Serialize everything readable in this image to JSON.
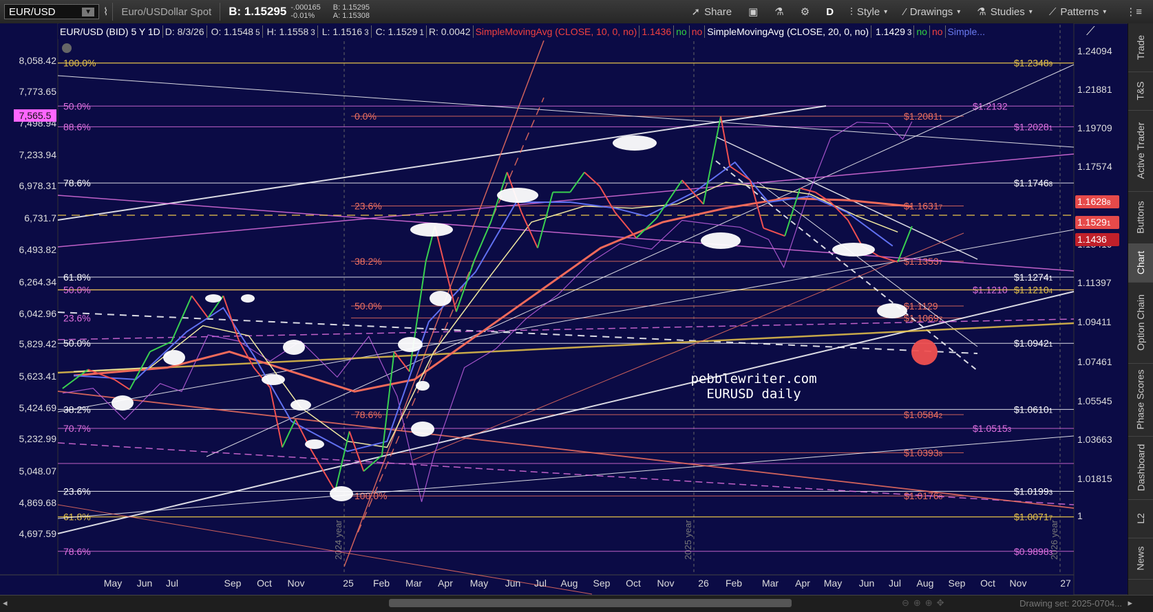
{
  "toolbar": {
    "symbol": "EUR/USD",
    "description": "Euro/USDollar Spot",
    "bid": "B: 1.15295",
    "change": "-.000165",
    "change_pct": "-0.01%",
    "bid_small": "B: 1.15295",
    "ask_small": "A: 1.15308",
    "share": "Share",
    "period": "D",
    "style": "Style",
    "drawings": "Drawings",
    "studies": "Studies",
    "patterns": "Patterns"
  },
  "infobar": {
    "title": "EUR/USD (BID) 5 Y 1D",
    "date": "D: 8/3/26",
    "open": "O: 1.1548",
    "open_sub": "5",
    "high": "H: 1.1558",
    "high_sub": "3",
    "low": "L: 1.1516",
    "low_sub": "3",
    "close": "C: 1.1529",
    "close_sub": "1",
    "range": "R: 0.0042",
    "sma10": "SimpleMovingAvg (CLOSE, 10, 0, no)",
    "sma10_val": "1.1436",
    "sma20": "SimpleMovingAvg (CLOSE, 20, 0, no)",
    "sma20_val": "1.1429",
    "sma20_sub": "3",
    "yes": "no",
    "no": "no",
    "more": "Simple..."
  },
  "sidebar": [
    "Trade",
    "T&S",
    "Active Trader",
    "Buttons",
    "Chart",
    "Option Chain",
    "Phase Scores",
    "Dashboard",
    "L2",
    "News"
  ],
  "bottombar": {
    "drawing_set": "Drawing set: 2025-0704..."
  },
  "watermark": [
    "pebblewriter.com",
    "EURUSD daily"
  ],
  "chart_data": {
    "type": "line",
    "title": "EUR/USD (BID) 5 Y 1D",
    "x_labels": [
      "May",
      "Jun",
      "Jul",
      "Sep",
      "Oct",
      "Nov",
      "25",
      "Feb",
      "Mar",
      "Apr",
      "May",
      "Jun",
      "Jul",
      "Aug",
      "Sep",
      "Oct",
      "Nov",
      "26",
      "Feb",
      "Mar",
      "Apr",
      "May",
      "Jun",
      "Jul",
      "Aug",
      "Sep",
      "Oct",
      "Nov",
      "27"
    ],
    "year_markers": [
      "2024 year",
      "2025 year",
      "2026 year"
    ],
    "y_right_ticks": [
      "1.24094",
      "1.21881",
      "1.19709",
      "1.17574",
      "1.15477",
      "1.13419",
      "1.11397",
      "1.09411",
      "1.07461",
      "1.05545",
      "1.03663",
      "1.01815",
      "1"
    ],
    "y_left_ticks": [
      "8,058.42",
      "7,773.65",
      "7,498.94",
      "7,233.94",
      "6,978.31",
      "6,731.7",
      "6,493.82",
      "6,264.34",
      "6,042.96",
      "5,829.42",
      "5,623.41",
      "5,424.69",
      "5,232.99",
      "5,048.07",
      "4,869.68",
      "4,697.59"
    ],
    "ylim": [
      0.978,
      1.254
    ],
    "price_markers": [
      {
        "label": "1.1628",
        "color": "#e64a4a",
        "sub": "8"
      },
      {
        "label": "1.1529",
        "color": "#e64a4a",
        "sub": "1"
      },
      {
        "label": "1.1436",
        "color": "#c0202a",
        "sub": ""
      }
    ],
    "left_marker": "7,565.5",
    "horizontal_levels": [
      {
        "price": 1.2348,
        "label": "$1.2348",
        "sub": "9",
        "color": "#e8c44a"
      },
      {
        "price": 1.2132,
        "label": "$1.2132",
        "sub": "",
        "color": "#e070e0"
      },
      {
        "price": 1.2081,
        "label": "$1.2081",
        "sub": "1",
        "color": "#f07060"
      },
      {
        "price": 1.2028,
        "label": "$1.2028",
        "sub": "1",
        "color": "#e070e0"
      },
      {
        "price": 1.1746,
        "label": "$1.1746",
        "sub": "8",
        "color": "#ffffff"
      },
      {
        "price": 1.1631,
        "label": "$1.1631",
        "sub": "7",
        "color": "#f07060"
      },
      {
        "price": 1.1353,
        "label": "$1.1353",
        "sub": "7",
        "color": "#f07060"
      },
      {
        "price": 1.1274,
        "label": "$1.1274",
        "sub": "1",
        "color": "#ffffff"
      },
      {
        "price": 1.121,
        "label": "$1.1210",
        "sub": "",
        "color": "#e070e0"
      },
      {
        "price": 1.121,
        "label": "$1.1210",
        "sub": "4",
        "color": "#e8c44a"
      },
      {
        "price": 1.1129,
        "label": "$1.1129",
        "sub": "",
        "color": "#f07060"
      },
      {
        "price": 1.1069,
        "label": "$1.1069",
        "sub": "7",
        "color": "#f07060"
      },
      {
        "price": 1.0942,
        "label": "$1.0942",
        "sub": "1",
        "color": "#ffffff"
      },
      {
        "price": 1.061,
        "label": "$1.0610",
        "sub": "1",
        "color": "#ffffff"
      },
      {
        "price": 1.0584,
        "label": "$1.0584",
        "sub": "2",
        "color": "#f07060"
      },
      {
        "price": 1.0515,
        "label": "$1.0515",
        "sub": "3",
        "color": "#e070e0"
      },
      {
        "price": 1.0393,
        "label": "$1.0393",
        "sub": "8",
        "color": "#f07060"
      },
      {
        "price": 1.0199,
        "label": "$1.0199",
        "sub": "3",
        "color": "#ffffff"
      },
      {
        "price": 1.0176,
        "label": "$1.0176",
        "sub": "8",
        "color": "#f07060"
      },
      {
        "price": 1.0071,
        "label": "$1.0071",
        "sub": "7",
        "color": "#e8c44a"
      },
      {
        "price": 0.9898,
        "label": "$0.9898",
        "sub": "3",
        "color": "#e070e0"
      }
    ],
    "fib_labels": [
      {
        "text": "100.0%",
        "color": "#e8c44a"
      },
      {
        "text": "50.0%",
        "color": "#e070e0"
      },
      {
        "text": "88.6%",
        "color": "#e070e0"
      },
      {
        "text": "78.6%",
        "color": "#ffffff"
      },
      {
        "text": "61.8%",
        "color": "#ffffff"
      },
      {
        "text": "50.0%",
        "color": "#e070e0"
      },
      {
        "text": "23.6%",
        "color": "#e070e0"
      },
      {
        "text": "50.0%",
        "color": "#ffffff"
      },
      {
        "text": "38.2%",
        "color": "#ffffff"
      },
      {
        "text": "70.7%",
        "color": "#e070e0"
      },
      {
        "text": "23.6%",
        "color": "#ffffff"
      },
      {
        "text": "61.8%",
        "color": "#e8c44a"
      },
      {
        "text": "78.6%",
        "color": "#e070e0"
      },
      {
        "text": "0.0%",
        "color": "#f07060"
      },
      {
        "text": "23.6%",
        "color": "#f07060"
      },
      {
        "text": "38.2%",
        "color": "#f07060"
      },
      {
        "text": "50.0%",
        "color": "#f07060"
      },
      {
        "text": "78.6%",
        "color": "#f07060"
      },
      {
        "text": "100.0%",
        "color": "#f07060"
      }
    ],
    "price_series": [
      [
        "2024-04-20",
        1.0715
      ],
      [
        "2024-05-15",
        1.081
      ],
      [
        "2024-06-10",
        1.076
      ],
      [
        "2024-06-25",
        1.071
      ],
      [
        "2024-07-15",
        1.09
      ],
      [
        "2024-08-05",
        1.095
      ],
      [
        "2024-08-25",
        1.118
      ],
      [
        "2024-09-10",
        1.107
      ],
      [
        "2024-09-25",
        1.118
      ],
      [
        "2024-10-10",
        1.096
      ],
      [
        "2024-10-25",
        1.082
      ],
      [
        "2024-11-10",
        1.072
      ],
      [
        "2024-11-22",
        1.042
      ],
      [
        "2024-12-05",
        1.056
      ],
      [
        "2024-12-20",
        1.041
      ],
      [
        "2025-01-13",
        1.02
      ],
      [
        "2025-01-27",
        1.05
      ],
      [
        "2025-02-10",
        1.03
      ],
      [
        "2025-02-28",
        1.038
      ],
      [
        "2025-03-12",
        1.09
      ],
      [
        "2025-03-27",
        1.08
      ],
      [
        "2025-04-12",
        1.135
      ],
      [
        "2025-04-21",
        1.153
      ],
      [
        "2025-05-12",
        1.11
      ],
      [
        "2025-05-30",
        1.136
      ],
      [
        "2025-06-15",
        1.155
      ],
      [
        "2025-07-01",
        1.18
      ],
      [
        "2025-07-15",
        1.16
      ],
      [
        "2025-07-31",
        1.142
      ],
      [
        "2025-08-15",
        1.17
      ],
      [
        "2025-09-01",
        1.17
      ],
      [
        "2025-09-15",
        1.18
      ],
      [
        "2025-09-30",
        1.173
      ],
      [
        "2025-10-15",
        1.16
      ],
      [
        "2025-11-05",
        1.147
      ],
      [
        "2025-11-25",
        1.157
      ],
      [
        "2025-12-20",
        1.176
      ],
      [
        "2026-01-10",
        1.164
      ],
      [
        "2026-01-27",
        1.208
      ],
      [
        "2026-02-05",
        1.183
      ],
      [
        "2026-02-25",
        1.176
      ],
      [
        "2026-03-10",
        1.152
      ],
      [
        "2026-03-31",
        1.148
      ],
      [
        "2026-04-15",
        1.172
      ],
      [
        "2026-04-30",
        1.17
      ],
      [
        "2026-05-15",
        1.165
      ],
      [
        "2026-06-01",
        1.156
      ],
      [
        "2026-06-15",
        1.143
      ],
      [
        "2026-07-01",
        1.138
      ],
      [
        "2026-07-20",
        1.135
      ],
      [
        "2026-08-03",
        1.1529
      ]
    ],
    "sma_blue": [
      [
        "2024-05-01",
        1.078
      ],
      [
        "2024-07-01",
        1.076
      ],
      [
        "2024-08-20",
        1.1
      ],
      [
        "2024-09-25",
        1.112
      ],
      [
        "2024-10-25",
        1.088
      ],
      [
        "2024-12-01",
        1.055
      ],
      [
        "2025-01-25",
        1.04
      ],
      [
        "2025-03-05",
        1.045
      ],
      [
        "2025-04-15",
        1.105
      ],
      [
        "2025-05-31",
        1.13
      ],
      [
        "2025-07-10",
        1.165
      ],
      [
        "2025-09-01",
        1.165
      ],
      [
        "2025-10-15",
        1.162
      ],
      [
        "2025-11-15",
        1.158
      ],
      [
        "2026-01-01",
        1.17
      ],
      [
        "2026-02-10",
        1.185
      ],
      [
        "2026-03-15",
        1.165
      ],
      [
        "2026-04-25",
        1.168
      ],
      [
        "2026-05-31",
        1.16
      ],
      [
        "2026-07-15",
        1.143
      ]
    ],
    "sma_yellow": [
      [
        "2024-05-01",
        1.08
      ],
      [
        "2024-07-15",
        1.082
      ],
      [
        "2024-09-05",
        1.103
      ],
      [
        "2024-10-20",
        1.098
      ],
      [
        "2024-12-10",
        1.062
      ],
      [
        "2025-01-25",
        1.045
      ],
      [
        "2025-03-05",
        1.042
      ],
      [
        "2025-04-20",
        1.09
      ],
      [
        "2025-06-10",
        1.125
      ],
      [
        "2025-07-25",
        1.155
      ],
      [
        "2025-09-15",
        1.163
      ],
      [
        "2025-11-01",
        1.162
      ],
      [
        "2025-12-15",
        1.164
      ],
      [
        "2026-02-01",
        1.175
      ],
      [
        "2026-03-15",
        1.172
      ],
      [
        "2026-04-25",
        1.169
      ],
      [
        "2026-06-10",
        1.158
      ],
      [
        "2026-07-20",
        1.15
      ]
    ],
    "sma_red": [
      [
        "2024-05-01",
        1.078
      ],
      [
        "2024-08-01",
        1.082
      ],
      [
        "2024-10-01",
        1.09
      ],
      [
        "2024-12-01",
        1.08
      ],
      [
        "2025-02-01",
        1.07
      ],
      [
        "2025-04-01",
        1.076
      ],
      [
        "2025-06-01",
        1.098
      ],
      [
        "2025-08-01",
        1.12
      ],
      [
        "2025-10-01",
        1.142
      ],
      [
        "2025-12-01",
        1.155
      ],
      [
        "2026-02-01",
        1.162
      ],
      [
        "2026-04-01",
        1.167
      ],
      [
        "2026-06-01",
        1.166
      ],
      [
        "2026-08-03",
        1.1628
      ]
    ],
    "index_series": [
      [
        "2024-04-20",
        5620
      ],
      [
        "2024-05-20",
        5650
      ],
      [
        "2024-06-20",
        5460
      ],
      [
        "2024-07-25",
        5680
      ],
      [
        "2024-08-15",
        5630
      ],
      [
        "2024-09-10",
        5990
      ],
      [
        "2024-10-10",
        5950
      ],
      [
        "2024-11-10",
        5820
      ],
      [
        "2024-12-10",
        5950
      ],
      [
        "2025-01-15",
        5720
      ],
      [
        "2025-02-15",
        5980
      ],
      [
        "2025-03-15",
        5600
      ],
      [
        "2025-04-08",
        4990
      ],
      [
        "2025-04-20",
        5250
      ],
      [
        "2025-05-20",
        5780
      ],
      [
        "2025-06-20",
        5900
      ],
      [
        "2025-07-20",
        6100
      ],
      [
        "2025-08-20",
        6260
      ],
      [
        "2025-09-20",
        6480
      ],
      [
        "2025-10-20",
        6620
      ],
      [
        "2025-11-20",
        6580
      ],
      [
        "2025-12-20",
        6790
      ],
      [
        "2026-01-20",
        6760
      ],
      [
        "2026-02-15",
        6740
      ],
      [
        "2026-03-15",
        6650
      ],
      [
        "2026-03-30",
        6450
      ],
      [
        "2026-04-20",
        6920
      ],
      [
        "2026-05-15",
        7430
      ],
      [
        "2026-06-10",
        7560
      ],
      [
        "2026-07-10",
        7550
      ],
      [
        "2026-07-25",
        7420
      ],
      [
        "2026-08-03",
        7565
      ]
    ],
    "colors": {
      "background": "#0b0b45",
      "price_up": "#39d050",
      "price_down": "#f05050",
      "sma_blue": "#6070f0",
      "sma_yellow": "#f0e8a0",
      "sma_red": "#f06a5a",
      "index": "#c060e0",
      "fib_gold": "#e8c44a",
      "fib_pink": "#e070e0",
      "fib_salmon": "#f07060"
    }
  }
}
